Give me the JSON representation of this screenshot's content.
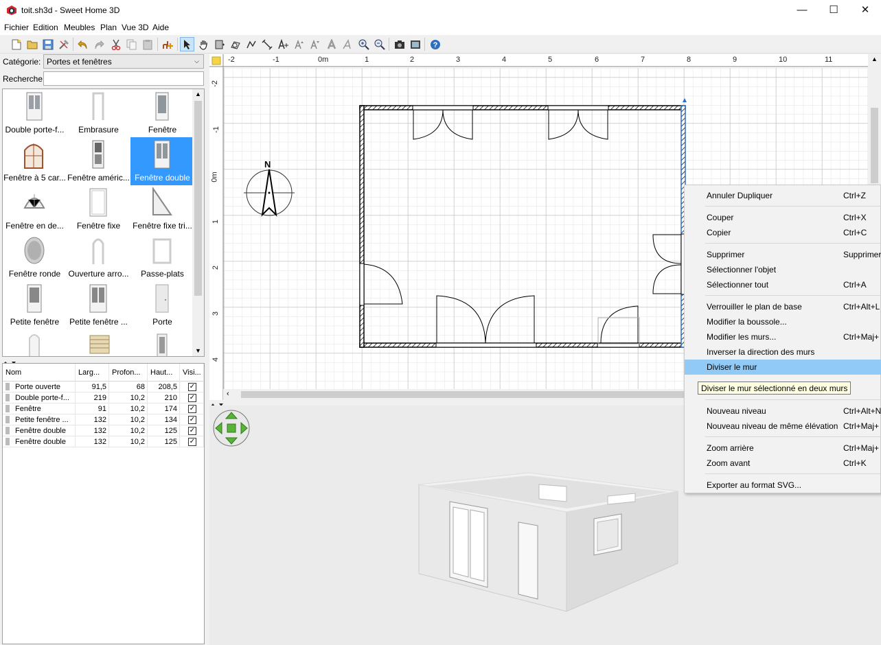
{
  "window": {
    "title": "toit.sh3d - Sweet Home 3D",
    "minimize": "—",
    "maximize": "☐",
    "close": "✕"
  },
  "menubar": [
    "Fichier",
    "Edition",
    "Meubles",
    "Plan",
    "Vue 3D",
    "Aide"
  ],
  "toolbar": {
    "buttons": [
      "new-icon",
      "open-icon",
      "save-icon",
      "preferences-icon",
      "undo-icon",
      "redo-icon",
      "cut-icon",
      "copy-icon",
      "paste-icon",
      "add-furniture-icon",
      "select-icon",
      "pan-icon",
      "create-rooms-icon",
      "create-polylines-icon",
      "create-dimensions-icon",
      "create-walls-icon",
      "add-text-icon",
      "increase-text-icon",
      "decrease-text-icon",
      "bold-icon",
      "italic-icon",
      "zoom-in-icon",
      "zoom-out-icon",
      "create-photo-icon",
      "create-video-icon",
      "help-icon"
    ]
  },
  "catalog": {
    "category_label": "Catégorie:",
    "category_value": "Portes et fenêtres",
    "search_label": "Recherche:",
    "search_value": "",
    "items": [
      {
        "label": "Double porte-f...",
        "selected": false
      },
      {
        "label": "Embrasure",
        "selected": false
      },
      {
        "label": "Fenêtre",
        "selected": false
      },
      {
        "label": "Fenêtre à 5 car...",
        "selected": false
      },
      {
        "label": "Fenêtre améric...",
        "selected": false
      },
      {
        "label": "Fenêtre double",
        "selected": true
      },
      {
        "label": "Fenêtre en de...",
        "selected": false
      },
      {
        "label": "Fenêtre fixe",
        "selected": false
      },
      {
        "label": "Fenêtre fixe tri...",
        "selected": false
      },
      {
        "label": "Fenêtre ronde",
        "selected": false
      },
      {
        "label": "Ouverture arro...",
        "selected": false
      },
      {
        "label": "Passe-plats",
        "selected": false
      },
      {
        "label": "Petite fenêtre",
        "selected": false
      },
      {
        "label": "Petite fenêtre ...",
        "selected": false
      },
      {
        "label": "Porte",
        "selected": false
      },
      {
        "label": "",
        "selected": false
      },
      {
        "label": "",
        "selected": false
      },
      {
        "label": "",
        "selected": false
      }
    ]
  },
  "furniture_table": {
    "columns": [
      "Nom",
      "Larg...",
      "Profon...",
      "Haut...",
      "Visi..."
    ],
    "rows": [
      {
        "name": "Porte ouverte",
        "width": "91,5",
        "depth": "68",
        "height": "208,5",
        "visible": "✓"
      },
      {
        "name": "Double porte-f...",
        "width": "219",
        "depth": "10,2",
        "height": "210",
        "visible": "✓"
      },
      {
        "name": "Fenêtre",
        "width": "91",
        "depth": "10,2",
        "height": "174",
        "visible": "✓"
      },
      {
        "name": "Petite fenêtre ...",
        "width": "132",
        "depth": "10,2",
        "height": "134",
        "visible": "✓"
      },
      {
        "name": "Fenêtre double",
        "width": "132",
        "depth": "10,2",
        "height": "125",
        "visible": "✓"
      },
      {
        "name": "Fenêtre double",
        "width": "132",
        "depth": "10,2",
        "height": "125",
        "visible": "✓"
      }
    ]
  },
  "plan": {
    "ruler_x": [
      "-2",
      "-1",
      "0m",
      "1",
      "2",
      "3",
      "4",
      "5",
      "6",
      "7",
      "8",
      "9",
      "10",
      "11"
    ],
    "ruler_y": [
      "-2",
      "-1",
      "0m",
      "1",
      "2",
      "3",
      "4"
    ],
    "compass_label": "N"
  },
  "context_menu": {
    "items": [
      {
        "label": "Annuler Dupliquer",
        "shortcut": "Ctrl+Z"
      },
      {
        "label": "Couper",
        "shortcut": "Ctrl+X"
      },
      {
        "label": "Copier",
        "shortcut": "Ctrl+C"
      },
      {
        "label": "Supprimer",
        "shortcut": "Supprimer"
      },
      {
        "label": "Sélectionner l'objet",
        "shortcut": ""
      },
      {
        "label": "Sélectionner tout",
        "shortcut": "Ctrl+A"
      },
      {
        "label": "Verrouiller le plan de base",
        "shortcut": "Ctrl+Alt+L"
      },
      {
        "label": "Modifier la boussole...",
        "shortcut": ""
      },
      {
        "label": "Modifier les murs...",
        "shortcut": "Ctrl+Maj+"
      },
      {
        "label": "Inverser la direction des murs",
        "shortcut": ""
      },
      {
        "label": "Diviser le mur",
        "shortcut": ""
      },
      {
        "label": "Nouveau niveau",
        "shortcut": "Ctrl+Alt+N"
      },
      {
        "label": "Nouveau niveau de même élévation",
        "shortcut": "Ctrl+Maj+"
      },
      {
        "label": "Zoom arrière",
        "shortcut": "Ctrl+Maj+"
      },
      {
        "label": "Zoom avant",
        "shortcut": "Ctrl+K"
      },
      {
        "label": "Exporter au format SVG...",
        "shortcut": ""
      }
    ],
    "tooltip": "Diviser le mur sélectionné en deux murs"
  }
}
